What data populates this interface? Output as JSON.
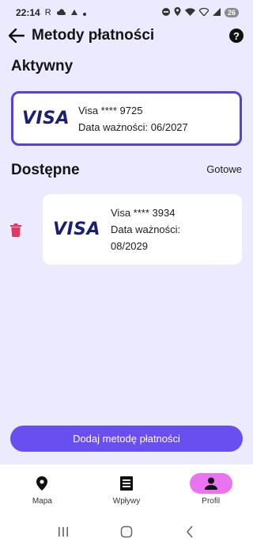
{
  "status_bar": {
    "time": "22:14",
    "left_letter": "R",
    "battery": "26",
    "icons": [
      "cloud-icon",
      "tiktok-icon",
      "dot-icon",
      "do-not-disturb-icon",
      "location-icon",
      "wifi-icon",
      "wifi-calling-icon",
      "signal-icon"
    ]
  },
  "header": {
    "title": "Metody płatności",
    "back_icon": "arrow-left-icon",
    "help_icon": "help-circle-icon",
    "help_glyph": "?"
  },
  "active_section": {
    "title": "Aktywny",
    "card": {
      "brand": "VISA",
      "number_line": "Visa **** 9725",
      "expiry_line": "Data ważności: 06/2027"
    }
  },
  "available_section": {
    "title": "Dostępne",
    "action_label": "Gotowe",
    "card": {
      "brand": "VISA",
      "number_line": "Visa **** 3934",
      "expiry_line_1": "Data ważności:",
      "expiry_line_2": "08/2029",
      "delete_icon": "trash-icon"
    }
  },
  "add_button": {
    "label": "Dodaj metodę płatności"
  },
  "bottom_nav": {
    "items": [
      {
        "label": "Mapa",
        "icon": "map-pin-icon",
        "active": false
      },
      {
        "label": "Wpływy",
        "icon": "receipt-icon",
        "active": false
      },
      {
        "label": "Profil",
        "icon": "person-icon",
        "active": true
      }
    ]
  },
  "colors": {
    "background": "#eceaff",
    "accent": "#5b3fd6",
    "button": "#6a4ff0",
    "active_nav": "#ea73f0",
    "delete": "#e8355f",
    "visa": "#1a1f71"
  }
}
